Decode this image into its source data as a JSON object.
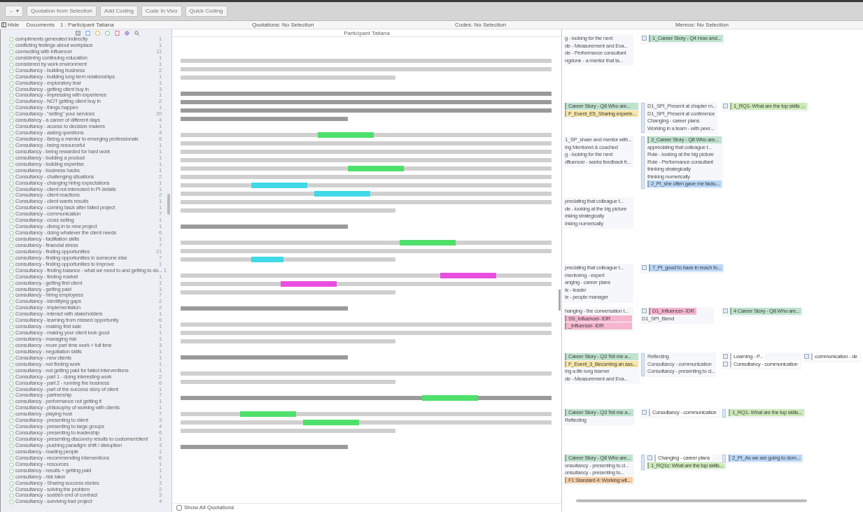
{
  "toolbar": {
    "nav_back": "←",
    "nav_menu": "▾",
    "buttons": [
      "Quotation from Selection",
      "Add Coding",
      "Code In Vivo",
      "Quick Coding"
    ]
  },
  "header": {
    "hide": "Hide",
    "documents_label": "Documents",
    "document": "1 : Participant Tatiana",
    "quotations": "Quotations: No Selection",
    "codes": "Codes: No Selection",
    "memos": "Memos: No Selection"
  },
  "document_title": "Participant Tatiana",
  "codes": [
    {
      "name": "compliments generated indirectly",
      "count": "1"
    },
    {
      "name": "conflicting feelings about workplace",
      "count": "1"
    },
    {
      "name": "connecting with influencer",
      "count": "11"
    },
    {
      "name": "considering continuing education",
      "count": "1"
    },
    {
      "name": "considered by work environment",
      "count": "1"
    },
    {
      "name": "Consultancy - building business",
      "count": "2"
    },
    {
      "name": "Consultancy - building long term relationships",
      "count": "1"
    },
    {
      "name": "Consultancy - exploratory fear",
      "count": "1"
    },
    {
      "name": "Consultancy - getting client buy in",
      "count": "3"
    },
    {
      "name": "Consultancy - impressing with experience",
      "count": "1"
    },
    {
      "name": "Consultancy - NOT getting client buy in",
      "count": "2"
    },
    {
      "name": "Consultancy - things happen",
      "count": "1"
    },
    {
      "name": "Consultancy - \"selling\" your services",
      "count": "20"
    },
    {
      "name": "consultancy - a career of different days",
      "count": "4"
    },
    {
      "name": "Consultancy - access to decision makers",
      "count": "1"
    },
    {
      "name": "Consultancy - asking questions",
      "count": "4"
    },
    {
      "name": "Consultancy - Being a mentor to emerging professionals",
      "count": "6"
    },
    {
      "name": "Consultancy - being resourceful",
      "count": "1"
    },
    {
      "name": "consultancy - being rewarded for hard work",
      "count": "1"
    },
    {
      "name": "consultancy - building a product",
      "count": "1"
    },
    {
      "name": "consultancy - building expertise",
      "count": "1"
    },
    {
      "name": "consultancy - business hacks",
      "count": "1"
    },
    {
      "name": "Consultancy - challenging situations",
      "count": "2"
    },
    {
      "name": "Consultancy - changing hiring expectations",
      "count": "1"
    },
    {
      "name": "Consultancy - client not interested in PI details",
      "count": "1"
    },
    {
      "name": "Consultancy - client reactions",
      "count": "2"
    },
    {
      "name": "Consultancy - client wants results",
      "count": "1"
    },
    {
      "name": "Consultancy - coming back after failed project",
      "count": "1"
    },
    {
      "name": "Consultancy - communication",
      "count": "7"
    },
    {
      "name": "Consultancy - cross selling",
      "count": "1"
    },
    {
      "name": "Consultancy - diving in to new project",
      "count": "1"
    },
    {
      "name": "Consultancy - doing whatever the client needs",
      "count": "6"
    },
    {
      "name": "consultancy - facilitation skills",
      "count": "1"
    },
    {
      "name": "consultancy - financial stress",
      "count": "7"
    },
    {
      "name": "consultancy - finding opportunities",
      "count": "21"
    },
    {
      "name": "consultancy - finding opportunities in someone else",
      "count": "7"
    },
    {
      "name": "consultancy - finding opportunities to improve",
      "count": "1"
    },
    {
      "name": "Consultancy - finding balance - what we need to and getting to do...",
      "count": "1"
    },
    {
      "name": "Consultancy - finding market",
      "count": "1"
    },
    {
      "name": "consultancy - getting first client",
      "count": "1"
    },
    {
      "name": "consultancy - getting paid",
      "count": "1"
    },
    {
      "name": "consultancy - hiring employees",
      "count": "7"
    },
    {
      "name": "Consultancy - identifying gaps",
      "count": "2"
    },
    {
      "name": "Consultancy - implementation",
      "count": "2"
    },
    {
      "name": "Consultancy - interact with stakeholders",
      "count": "1"
    },
    {
      "name": "Consultancy - learning from missed opportunity",
      "count": "6"
    },
    {
      "name": "consultancy - making first sale",
      "count": "1"
    },
    {
      "name": "Consultancy - making your client look good",
      "count": "1"
    },
    {
      "name": "consultancy - managing risk",
      "count": "1"
    },
    {
      "name": "consultancy - more part time work + full time",
      "count": "3"
    },
    {
      "name": "consultancy - negotiation skills",
      "count": "1"
    },
    {
      "name": "Consultancy - new clients",
      "count": "1"
    },
    {
      "name": "consultancy - not finding work",
      "count": "1"
    },
    {
      "name": "consultancy - not getting paid for failed interventions",
      "count": "1"
    },
    {
      "name": "Consultancy - part 1 - doing interesting work",
      "count": "2"
    },
    {
      "name": "Consultancy - part 2 - running the business",
      "count": "6"
    },
    {
      "name": "Consultancy - part of the success story of client",
      "count": "1"
    },
    {
      "name": "Consultancy - partnership",
      "count": "7"
    },
    {
      "name": "consultancy - performance not getting it",
      "count": "1"
    },
    {
      "name": "Consultancy - philosophy of working with clients",
      "count": "1"
    },
    {
      "name": "consultancy - playing host",
      "count": "7"
    },
    {
      "name": "Consultancy - presenting to client",
      "count": "3"
    },
    {
      "name": "Consultancy - presenting to large groups",
      "count": "4"
    },
    {
      "name": "Consultancy - presenting to leadership",
      "count": "6"
    },
    {
      "name": "Consultancy - presenting discovery results to customer/client",
      "count": "1"
    },
    {
      "name": "Consultancy - pushing paradigm shift / disruption",
      "count": "3"
    },
    {
      "name": "consultancy - reading people",
      "count": "1"
    },
    {
      "name": "Consultancy - recommending interventions",
      "count": "6"
    },
    {
      "name": "Consultancy - resources",
      "count": "1"
    },
    {
      "name": "consultancy - results + getting paid",
      "count": "1"
    },
    {
      "name": "consultancy - risk taker",
      "count": "1"
    },
    {
      "name": "Consultancy - Sharing success stories",
      "count": "3"
    },
    {
      "name": "Consultancy - solving the problem",
      "count": "2"
    },
    {
      "name": "Consultancy - sudden end of contract",
      "count": "3"
    },
    {
      "name": "Consultancy - surviving bad project",
      "count": "4"
    }
  ],
  "paragraphs": [
    {
      "kind": "answer",
      "lines": [
        {
          "kind": "full"
        },
        {
          "kind": "full"
        },
        {
          "kind": "short"
        }
      ]
    },
    {
      "kind": "question",
      "lines": [
        {
          "kind": "full"
        },
        {
          "kind": "full"
        },
        {
          "kind": "full"
        },
        {
          "kind": "short"
        }
      ]
    },
    {
      "kind": "answer",
      "lines": [
        {
          "kind": "full",
          "highlights": [
            {
              "color": "#4ee06a"
            }
          ]
        },
        {
          "kind": "full"
        },
        {
          "kind": "full"
        },
        {
          "kind": "full"
        },
        {
          "kind": "full",
          "highlights": [
            {
              "color": "#4ee06a"
            }
          ]
        },
        {
          "kind": "full"
        },
        {
          "kind": "full",
          "highlights": [
            {
              "color": "#3fd9e8"
            }
          ]
        },
        {
          "kind": "full",
          "highlights": [
            {
              "color": "#3fd9e8"
            }
          ]
        },
        {
          "kind": "full"
        },
        {
          "kind": "short"
        }
      ]
    },
    {
      "kind": "question",
      "lines": [
        {
          "kind": "short"
        }
      ]
    },
    {
      "kind": "answer",
      "lines": [
        {
          "kind": "full",
          "highlights": [
            {
              "color": "#4ee06a"
            }
          ]
        },
        {
          "kind": "full"
        },
        {
          "kind": "short",
          "highlights": [
            {
              "color": "#3fd9e8"
            }
          ]
        }
      ]
    },
    {
      "kind": "answer",
      "lines": [
        {
          "kind": "full",
          "highlights": [
            {
              "color": "#e84fe0"
            }
          ]
        },
        {
          "kind": "full",
          "highlights": [
            {
              "color": "#e84fe0"
            }
          ]
        },
        {
          "kind": "short"
        }
      ]
    },
    {
      "kind": "question",
      "lines": [
        {
          "kind": "short"
        }
      ]
    },
    {
      "kind": "answer",
      "lines": [
        {
          "kind": "full"
        },
        {
          "kind": "full"
        },
        {
          "kind": "short"
        }
      ]
    },
    {
      "kind": "question",
      "lines": [
        {
          "kind": "short"
        }
      ]
    },
    {
      "kind": "answer",
      "lines": [
        {
          "kind": "full"
        },
        {
          "kind": "short"
        }
      ]
    },
    {
      "kind": "question",
      "lines": [
        {
          "kind": "full",
          "highlights": [
            {
              "color": "#4ee06a"
            }
          ]
        }
      ]
    },
    {
      "kind": "answer",
      "lines": [
        {
          "kind": "full",
          "highlights": [
            {
              "color": "#4ee06a"
            }
          ]
        },
        {
          "kind": "full",
          "highlights": [
            {
              "color": "#4ee06a"
            }
          ]
        },
        {
          "kind": "short"
        }
      ]
    },
    {
      "kind": "question",
      "lines": [
        {
          "kind": "short"
        }
      ]
    }
  ],
  "margin": {
    "bands": [
      {
        "columns": [
          {
            "tabbed": false,
            "entries": [
              {
                "kind": "line",
                "text": "g - looking for the next"
              },
              {
                "kind": "line",
                "text": "de - Measurement and Eva..."
              },
              {
                "kind": "line",
                "text": "de - Performance consultant"
              },
              {
                "kind": "line",
                "text": "ngdone - a mentor that ta..."
              }
            ]
          },
          {
            "tabbed": false,
            "entries": [
              {
                "kind": "tagged",
                "text": "1_Career Story - Q4 How and...",
                "color": "#bfe3cd"
              }
            ]
          }
        ]
      },
      {
        "columns": [
          {
            "tabbed": false,
            "entries": [
              {
                "kind": "label",
                "text": "Career Story - Q8 Who are...",
                "color": "#bfe3cd"
              },
              {
                "kind": "label",
                "text": "F_Event_E5_Sharing experie...",
                "color": "#f7e6a6"
              }
            ]
          },
          {
            "tabbed": true,
            "entries": [
              {
                "kind": "line",
                "text": "D1_SPI_Present at chapter m..."
              },
              {
                "kind": "line",
                "text": "D1_SPI_Present at conference"
              },
              {
                "kind": "line",
                "text": "Changing - career plans"
              },
              {
                "kind": "line",
                "text": "Working in a team - with peer..."
              }
            ]
          },
          {
            "tabbed": false,
            "entries": [
              {
                "kind": "tagged",
                "text": "1_RQ1- What are the top skills ...",
                "color": "#cdeab8"
              }
            ]
          }
        ]
      },
      {
        "columns": [
          {
            "tabbed": false,
            "entries": [
              {
                "kind": "line",
                "text": "1_SP_share and mentor with..."
              },
              {
                "kind": "line",
                "text": "ing Mentored & coached"
              },
              {
                "kind": "line",
                "text": "g - looking for the next"
              },
              {
                "kind": "line",
                "text": "dfluencer - seeks feedback fr..."
              }
            ]
          },
          {
            "tabbed": true,
            "entries": [
              {
                "kind": "label",
                "text": "3_Career Story - Q8 Who are...",
                "color": "#bfe3cd"
              },
              {
                "kind": "line",
                "text": "appreciating that colleague t..."
              },
              {
                "kind": "line",
                "text": "Role - looking at the big picture"
              },
              {
                "kind": "line",
                "text": "Role - Performance consultant"
              },
              {
                "kind": "line",
                "text": "thinking strategically"
              },
              {
                "kind": "line",
                "text": "thinking numerically"
              },
              {
                "kind": "label",
                "text": "2_PI_she often gave me factu...",
                "color": "#b9d6f7"
              }
            ]
          }
        ]
      },
      {
        "columns": [
          {
            "tabbed": false,
            "entries": [
              {
                "kind": "line",
                "text": "preciating that colleague t..."
              },
              {
                "kind": "line",
                "text": "de - looking at the big picture"
              },
              {
                "kind": "line",
                "text": "inking strategically"
              },
              {
                "kind": "line",
                "text": "inking numerically"
              }
            ]
          }
        ]
      },
      {
        "columns": [
          {
            "tabbed": false,
            "entries": [
              {
                "kind": "line",
                "text": "preciating that colleague t..."
              },
              {
                "kind": "line",
                "text": "mentoring - expert"
              },
              {
                "kind": "line",
                "text": "anging - career plans"
              },
              {
                "kind": "line",
                "text": "le - leader"
              },
              {
                "kind": "line",
                "text": "le - people manager"
              }
            ]
          },
          {
            "tabbed": false,
            "entries": [
              {
                "kind": "tagged",
                "text": "7_PI_good to have in reach fo...",
                "color": "#b9d6f7"
              }
            ]
          }
        ]
      },
      {
        "columns": [
          {
            "tabbed": false,
            "entries": [
              {
                "kind": "line",
                "text": "hanging - the conversation t..."
              },
              {
                "kind": "label",
                "text": "SS_Influencer- IDR",
                "color": "#f5b6cd"
              },
              {
                "kind": "label",
                "text": "_Influencer- IDR",
                "color": "#f5b6cd"
              }
            ]
          },
          {
            "tabbed": false,
            "entries": [
              {
                "kind": "tagged",
                "text": "D1_Influencer- IDR",
                "color": "#f5b6cd"
              },
              {
                "kind": "line",
                "text": "D1_SPI_Blend"
              }
            ]
          },
          {
            "tabbed": false,
            "entries": [
              {
                "kind": "tagged",
                "text": "4 Career Story - Q8 Who are...",
                "color": "#bfe3cd"
              }
            ]
          }
        ]
      },
      {
        "columns": [
          {
            "tabbed": false,
            "entries": [
              {
                "kind": "label",
                "text": "Career Story - Q3 Tell me a...",
                "color": "#bfe3cd"
              },
              {
                "kind": "label",
                "text": "F_Event_3_Becoming an ass...",
                "color": "#f7e6a6"
              },
              {
                "kind": "line",
                "text": "ing a life long learner"
              },
              {
                "kind": "line",
                "text": "de - Measurement and Eva..."
              }
            ]
          },
          {
            "tabbed": true,
            "entries": [
              {
                "kind": "line",
                "text": "Reflecting"
              },
              {
                "kind": "line",
                "text": "Consultancy - communication"
              },
              {
                "kind": "line",
                "text": "Consultancy - presenting to cl..."
              }
            ]
          },
          {
            "tabbed": false,
            "entries": [
              {
                "kind": "tagged",
                "text": "Learning - P...",
                "color": "#ffffff"
              },
              {
                "kind": "tagged",
                "text": "Consultancy - communication",
                "color": "#ffffff"
              }
            ]
          },
          {
            "tabbed": false,
            "entries": [
              {
                "kind": "tagged",
                "text": "communication - de",
                "color": "#ffffff"
              }
            ]
          }
        ]
      },
      {
        "columns": [
          {
            "tabbed": false,
            "entries": [
              {
                "kind": "label",
                "text": "Career Story - Q3 Tell me a...",
                "color": "#bfe3cd"
              },
              {
                "kind": "line",
                "text": "Reflecting"
              }
            ]
          },
          {
            "tabbed": false,
            "entries": [
              {
                "kind": "tagged",
                "text": "Consultancy - communication",
                "color": "#ffffff"
              }
            ]
          },
          {
            "tabbed": true,
            "entries": [
              {
                "kind": "label",
                "text": "1_RQ1- What are the top skills...",
                "color": "#cdeab8"
              }
            ]
          }
        ]
      },
      {
        "columns": [
          {
            "tabbed": false,
            "entries": [
              {
                "kind": "label",
                "text": "Career Story - Q8 Who are...",
                "color": "#bfe3cd"
              },
              {
                "kind": "line",
                "text": "onsultancy - presenting to cl..."
              },
              {
                "kind": "line",
                "text": "onsultancy - presenting to..."
              },
              {
                "kind": "label",
                "text": "F1 Standard 4: Working wit...",
                "color": "#f8cfa6"
              }
            ]
          },
          {
            "tabbed": true,
            "entries": [
              {
                "kind": "tagged",
                "text": "Changing - career plans",
                "color": "#ffffff"
              },
              {
                "kind": "label",
                "text": "1_RQ1c: What are the top skills...",
                "color": "#cdeab8"
              }
            ]
          },
          {
            "tabbed": true,
            "entries": [
              {
                "kind": "label",
                "text": "2_PI_As we are going to dom...",
                "color": "#b9d6f7"
              }
            ]
          }
        ]
      }
    ]
  },
  "show_all": {
    "label": "Show All Quotations",
    "checked": false
  }
}
